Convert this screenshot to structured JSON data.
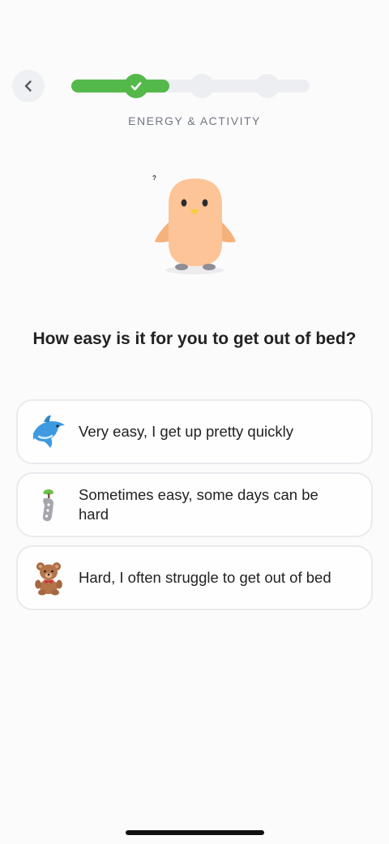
{
  "header": {
    "back_icon": "chevron-left-icon",
    "progress": {
      "steps_total": 3,
      "steps_completed": 1,
      "fill_fraction": 0.41,
      "accent_color": "#54b94a",
      "check_icon": "checkmark-icon"
    },
    "section_label": "ENERGY & ACTIVITY"
  },
  "mascot": {
    "icon": "chick-mascot-icon",
    "thought_mark": "?"
  },
  "question": "How easy is it for you to get out of bed?",
  "options": [
    {
      "icon": "dolphin-icon",
      "label": "Very easy, I get up pretty quickly"
    },
    {
      "icon": "sloth-on-branch-icon",
      "label": "Sometimes easy, some days can be hard"
    },
    {
      "icon": "teddy-bear-icon",
      "label": "Hard, I often struggle to get out of bed"
    }
  ]
}
